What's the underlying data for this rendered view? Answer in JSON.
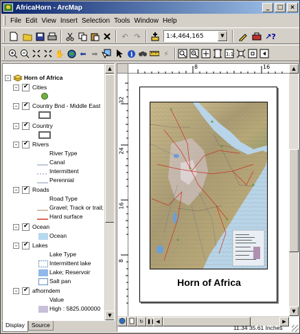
{
  "window": {
    "title": "AfricaHorn - ArcMap",
    "minimize": "_",
    "maximize": "□",
    "close": "×"
  },
  "menu": [
    "File",
    "Edit",
    "View",
    "Insert",
    "Selection",
    "Tools",
    "Window",
    "Help"
  ],
  "standard_toolbar": {
    "scale": "1:4,464,165",
    "icons": [
      "new-document-icon",
      "open-folder-icon",
      "save-icon",
      "print-icon",
      "cut-icon",
      "copy-icon",
      "paste-icon",
      "delete-icon",
      "undo-icon",
      "redo-icon",
      "add-data-icon",
      "editor-icon",
      "arctoolbox-icon",
      "whats-this-icon"
    ]
  },
  "tools_toolbar": {
    "icons": [
      "zoom-in-icon",
      "zoom-out-icon",
      "fixed-zoom-in-icon",
      "fixed-zoom-out-icon",
      "pan-icon",
      "full-extent-icon",
      "back-icon",
      "forward-icon",
      "select-features-icon",
      "select-elements-icon",
      "identify-icon",
      "find-icon",
      "measure-icon",
      "hyperlink-icon",
      "layout-zoom-in-icon",
      "layout-zoom-out-icon",
      "layout-pan-icon",
      "zoom-whole-page-icon",
      "zoom-100-icon",
      "layout-fixed-zoom-in-icon",
      "layout-fixed-zoom-out-icon",
      "page-back-icon"
    ]
  },
  "toc": {
    "data_frame": "Horn of Africa",
    "layers": [
      {
        "name": "Cities",
        "symbol": "point-green"
      },
      {
        "name": "Country Bnd - Middle East",
        "symbol": "box"
      },
      {
        "name": "Country",
        "symbol": "box"
      },
      {
        "name": "Rivers",
        "field": "River Type",
        "classes": [
          {
            "label": "Canal",
            "symbol": "line-solid"
          },
          {
            "label": "Intermittent",
            "symbol": "line-dashed"
          },
          {
            "label": "Perennial",
            "symbol": "line-solid"
          }
        ]
      },
      {
        "name": "Roads",
        "field": "Road Type",
        "classes": [
          {
            "label": "Gravel; Track or trail;",
            "symbol": "road-gravel"
          },
          {
            "label": "Hard surface",
            "symbol": "road-hard"
          }
        ]
      },
      {
        "name": "Ocean",
        "classes": [
          {
            "label": "Ocean",
            "symbol": "fill-lightblue"
          }
        ]
      },
      {
        "name": "Lakes",
        "field": "Lake Type",
        "classes": [
          {
            "label": "Intermittent lake",
            "symbol": "fill-dashed"
          },
          {
            "label": "Lake; Reservoir",
            "symbol": "fill-blue"
          },
          {
            "label": "Salt pan",
            "symbol": "fill-white"
          }
        ]
      },
      {
        "name": "afhorndem",
        "field": "Value",
        "classes": [
          {
            "label": "High : 5825.000000",
            "symbol": "ramp-high"
          }
        ]
      }
    ],
    "tabs": [
      "Display",
      "Source"
    ]
  },
  "layout": {
    "hruler": [
      "8",
      "16"
    ],
    "vruler": [
      "32",
      "24",
      "16",
      "8"
    ],
    "map_title": "Horn of Africa"
  },
  "status": {
    "coordinates": "11.34  35.61 Inches"
  },
  "colors": {
    "title_bar_start": "#0a246a",
    "title_bar_end": "#a6caf0",
    "chrome": "#d4d0c8"
  }
}
